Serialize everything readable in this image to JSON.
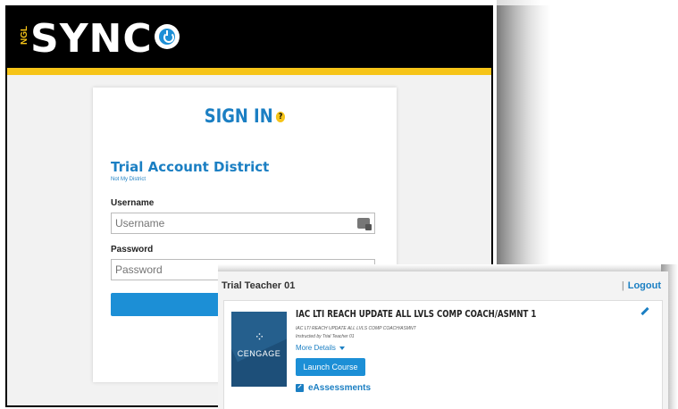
{
  "login_page": {
    "logo": {
      "prefix": "NGL",
      "wordmark": "SYNC"
    },
    "title": "SIGN IN",
    "help_icon": "?",
    "district": "Trial Account District",
    "not_my_district": "Not My District",
    "username_label": "Username",
    "username_placeholder": "Username",
    "password_label": "Password",
    "password_placeholder": "Password",
    "accent_color": "#f6c418",
    "primary_color": "#1c8fd6"
  },
  "course_page": {
    "user_name": "Trial Teacher 01",
    "logout_separator": "|",
    "logout_label": "Logout",
    "course": {
      "thumbnail_text": "CENGAGE",
      "title": "IAC LTI REACH UPDATE ALL LVLS COMP COACH/ASMNT 1",
      "subtitle": "IAC LTI REACH UPDATE ALL LVLS COMP COACH/ASMNT",
      "instructor": "Instructed by Trial Teacher 01",
      "more_details": "More Details",
      "launch_button": "Launch Course",
      "eassessments": "eAssessments"
    }
  }
}
